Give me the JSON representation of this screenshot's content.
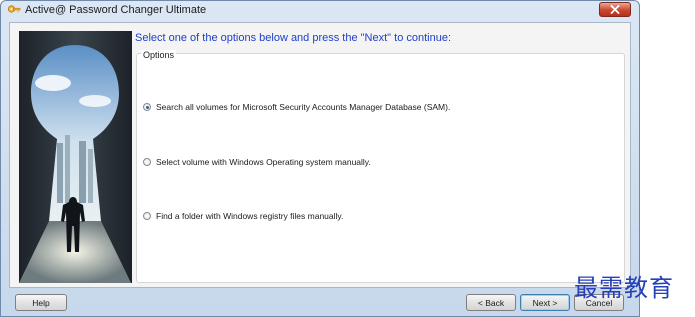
{
  "window": {
    "title": "Active@ Password Changer Ultimate",
    "close_icon": "close-icon"
  },
  "wizard": {
    "instruction": "Select one of the options below and press the \"Next\" to continue:",
    "group_label": "Options",
    "options": [
      {
        "label": "Search all volumes for Microsoft Security Accounts Manager Database (SAM).",
        "selected": true
      },
      {
        "label": "Select volume with Windows Operating system manually.",
        "selected": false
      },
      {
        "label": "Find a folder with Windows registry files manually.",
        "selected": false
      }
    ]
  },
  "buttons": {
    "help": "Help",
    "back": "< Back",
    "next": "Next >",
    "cancel": "Cancel"
  },
  "watermark": "最需教育",
  "colors": {
    "instruction_text": "#1e3fc9",
    "close_button": "#c9462c",
    "watermark": "#2740b8"
  }
}
